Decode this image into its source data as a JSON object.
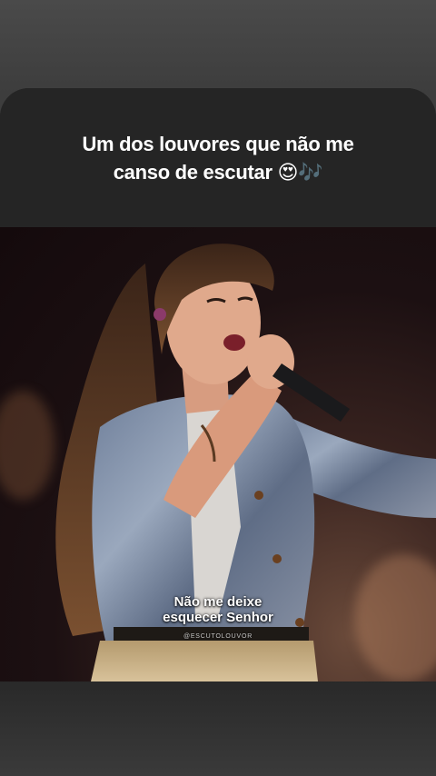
{
  "story": {
    "caption_line1": "Um dos louvores que não me",
    "caption_line2": "canso de escutar 😍🎶",
    "lyric_line1": "Não  me deixe",
    "lyric_line2": "esquecer Senhor",
    "watermark": "@ESCUTOLOUVOR"
  },
  "colors": {
    "background": "#3a3a3a",
    "card": "#262626",
    "caption_text": "#ffffff"
  }
}
